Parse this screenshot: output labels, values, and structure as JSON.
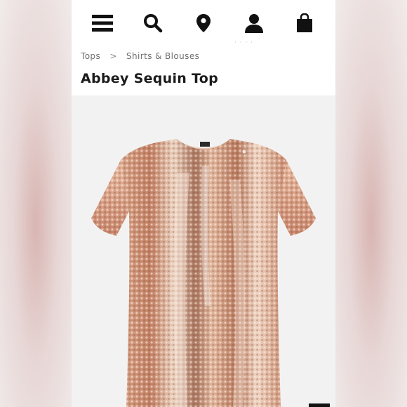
{
  "nav": {
    "menu_icon": "hamburger-menu-icon",
    "search_icon": "search-icon",
    "location_icon": "map-pin-icon",
    "account_icon": "user-icon",
    "bag_icon": "shopping-bag-icon"
  },
  "breadcrumb": {
    "items": [
      "Tops",
      "Shirts & Blouses"
    ],
    "separator": ">"
  },
  "product": {
    "title": "Abbey Sequin Top",
    "image": "rose-gold-sequin-short-sleeve-top"
  },
  "colors": {
    "background": "#ffffff",
    "text": "#1b1b1b",
    "breadcrumb": "#6e6e6e",
    "sequin_base": "#c98a6e",
    "sequin_highlight": "#f6dccb"
  }
}
